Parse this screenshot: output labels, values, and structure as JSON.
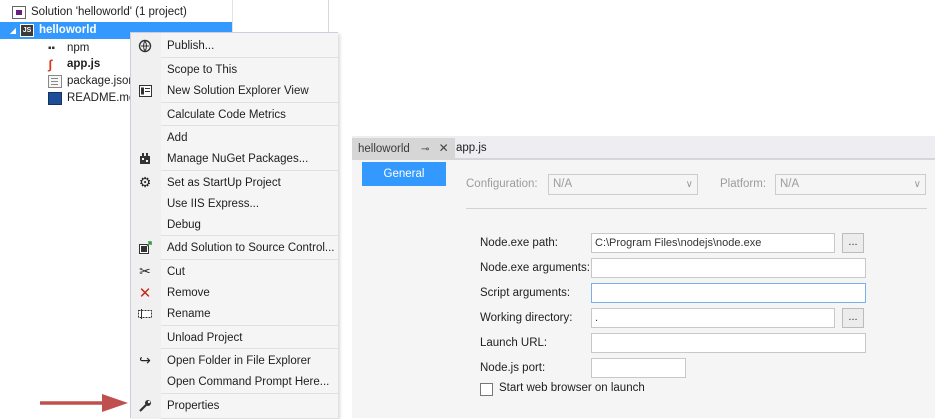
{
  "solution_explorer": {
    "solution_label": "Solution 'helloworld' (1 project)",
    "project_label": "helloworld",
    "items": [
      {
        "label": "npm",
        "icon": "npm-icon"
      },
      {
        "label": "app.js",
        "icon": "js-file-icon"
      },
      {
        "label": "package.json",
        "icon": "json-file-icon"
      },
      {
        "label": "README.md",
        "icon": "markdown-file-icon"
      }
    ]
  },
  "context_menu": {
    "items": [
      {
        "label": "Publish...",
        "icon": "globe-icon"
      },
      {
        "label": "Scope to This",
        "icon": ""
      },
      {
        "label": "New Solution Explorer View",
        "icon": "new-view-icon"
      },
      {
        "label": "Calculate Code Metrics",
        "icon": ""
      },
      {
        "label": "Add",
        "icon": ""
      },
      {
        "label": "Manage NuGet Packages...",
        "icon": "nuget-icon"
      },
      {
        "label": "Set as StartUp Project",
        "icon": "gear-icon"
      },
      {
        "label": "Use IIS Express...",
        "icon": ""
      },
      {
        "label": "Debug",
        "icon": ""
      },
      {
        "label": "Add Solution to Source Control...",
        "icon": "source-control-icon"
      },
      {
        "label": "Cut",
        "icon": "scissors-icon"
      },
      {
        "label": "Remove",
        "icon": "remove-x-icon"
      },
      {
        "label": "Rename",
        "icon": "rename-icon"
      },
      {
        "label": "Unload Project",
        "icon": ""
      },
      {
        "label": "Open Folder in File Explorer",
        "icon": "open-folder-icon"
      },
      {
        "label": "Open Command Prompt Here...",
        "icon": ""
      },
      {
        "label": "Properties",
        "icon": "wrench-icon"
      }
    ]
  },
  "document_tabs": {
    "active": "helloworld",
    "other": "app.js",
    "pin_glyph": "⊸",
    "close_glyph": "✕"
  },
  "properties": {
    "general_tab": "General",
    "configuration_label": "Configuration:",
    "configuration_value": "N/A",
    "platform_label": "Platform:",
    "platform_value": "N/A",
    "fields": {
      "node_exe_path_label": "Node.exe path:",
      "node_exe_path_value": "C:\\Program Files\\nodejs\\node.exe",
      "node_exe_args_label": "Node.exe arguments:",
      "node_exe_args_value": "",
      "script_args_label": "Script arguments:",
      "script_args_value": "",
      "working_dir_label": "Working directory:",
      "working_dir_value": ".",
      "launch_url_label": "Launch URL:",
      "launch_url_value": "",
      "node_port_label": "Node.js port:",
      "node_port_value": ""
    },
    "browse_label": "...",
    "start_browser_label": "Start web browser on launch",
    "start_browser_checked": false
  },
  "colors": {
    "accent": "#3399ff",
    "arrow": "#c0504d"
  }
}
